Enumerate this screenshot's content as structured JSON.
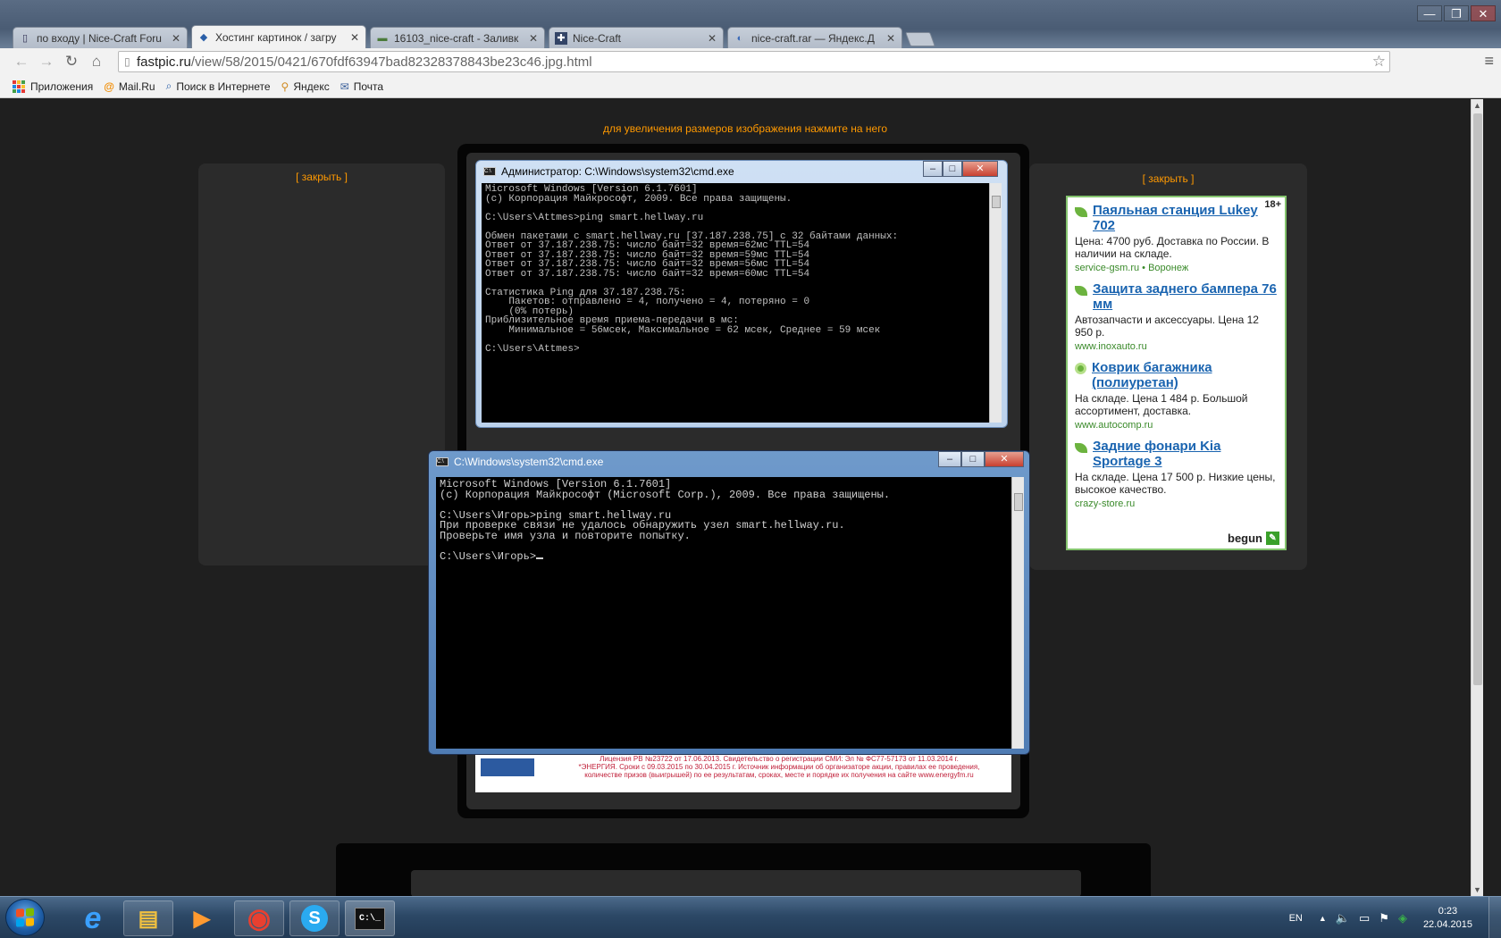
{
  "browser": {
    "tabs": [
      {
        "label": "по входу | Nice-Craft Foru",
        "icon": "page-icon"
      },
      {
        "label": "Хостинг картинок / загру",
        "icon": "fastpic-icon"
      },
      {
        "label": "16103_nice-craft - Заливк",
        "icon": "image-icon"
      },
      {
        "label": "Nice-Craft",
        "icon": "nicecraft-icon"
      },
      {
        "label": "nice-craft.rar — Яндекс.Д",
        "icon": "yadisk-icon"
      }
    ],
    "close_glyph": "✕",
    "url_host": "fastpic.ru",
    "url_path": "/view/58/2015/0421/670fdf63947bad82328378843be23c46.jpg.html",
    "bookmarks": [
      "Приложения",
      "Mail.Ru",
      "Поиск в Интернете",
      "Яндекс",
      "Почта"
    ],
    "window_controls": [
      "—",
      "❐",
      "✕"
    ]
  },
  "page": {
    "hint": "для увеличения размеров изображения нажмите на него",
    "close_left": "[ закрыть ]",
    "close_right": "[ закрыть ]",
    "image_footer_lines": [
      "Лицензия РВ №23722 от 17.06.2013. Свидетельство о регистрации СМИ: Эл № ФС77-57173 от 11.03.2014 г.",
      "*ЭНЕРГИЯ. Сроки с 09.03.2015 по 30.04.2015 г. Источник информации об организаторе акции, правилах ее проведения,",
      "количестве призов (выигрышей) по ее результатам, сроках, месте и порядке их получения на сайте www.energyfm.ru"
    ]
  },
  "ad": {
    "age": "18+",
    "items": [
      {
        "title": "Паяльная станция Lukey 702",
        "desc": "Цена: 4700 руб. Доставка по России. В наличии на складе.",
        "url": "service-gsm.ru  •  Воронеж",
        "icon": "leaf-icon"
      },
      {
        "title": "Защита заднего бампера 76 мм",
        "desc": "Автозапчасти и аксессуары. Цена 12 950 р.",
        "url": "www.inoxauto.ru",
        "icon": "leaf-icon"
      },
      {
        "title": "Коврик багажника (полиуретан)",
        "desc": "На складе. Цена 1 484 р. Большой ассортимент, доставка.",
        "url": "www.autocomp.ru",
        "icon": "circle-icon"
      },
      {
        "title": "Задние фонари Kia Sportage 3",
        "desc": "На складе. Цена 17 500 р. Низкие цены, высокое качество.",
        "url": "crazy-store.ru",
        "icon": "leaf-icon"
      }
    ],
    "brand": "begun"
  },
  "cmd_screenshot": {
    "title": "Администратор: C:\\Windows\\system32\\cmd.exe",
    "lines": [
      "Microsoft Windows [Version 6.1.7601]",
      "(c) Корпорация Майкрософт, 2009. Все права защищены.",
      "",
      "C:\\Users\\Attmes>ping smart.hellway.ru",
      "",
      "Обмен пакетами с smart.hellway.ru [37.187.238.75] с 32 байтами данных:",
      "Ответ от 37.187.238.75: число байт=32 время=62мс TTL=54",
      "Ответ от 37.187.238.75: число байт=32 время=59мс TTL=54",
      "Ответ от 37.187.238.75: число байт=32 время=56мс TTL=54",
      "Ответ от 37.187.238.75: число байт=32 время=60мс TTL=54",
      "",
      "Статистика Ping для 37.187.238.75:",
      "    Пакетов: отправлено = 4, получено = 4, потеряно = 0",
      "    (0% потерь)",
      "Приблизительное время приема-передачи в мс:",
      "    Минимальное = 56мсек, Максимальное = 62 мсек, Среднее = 59 мсек",
      "",
      "C:\\Users\\Attmes>"
    ]
  },
  "cmd_live": {
    "title": "C:\\Windows\\system32\\cmd.exe",
    "lines": [
      "Microsoft Windows [Version 6.1.7601]",
      "(c) Корпорация Майкрософт (Microsoft Corp.), 2009. Все права защищены.",
      "",
      "C:\\Users\\Игорь>ping smart.hellway.ru",
      "При проверке связи не удалось обнаружить узел smart.hellway.ru.",
      "Проверьте имя узла и повторите попытку.",
      ""
    ],
    "prompt": "C:\\Users\\Игорь>"
  },
  "taskbar": {
    "apps": [
      {
        "name": "internet-explorer",
        "glyph": "e",
        "color": "#3aa0ff"
      },
      {
        "name": "file-explorer",
        "glyph": "▤",
        "color": "#f0c040"
      },
      {
        "name": "media-player",
        "glyph": "▶",
        "color": "#ff9a30"
      },
      {
        "name": "chrome",
        "glyph": "◉",
        "color": "#e84030"
      },
      {
        "name": "skype",
        "glyph": "S",
        "color": "#2aaaf0"
      },
      {
        "name": "cmd",
        "glyph": "C:\\_",
        "color": "#ffffff"
      }
    ],
    "lang": "EN",
    "time": "0:23",
    "date": "22.04.2015"
  }
}
